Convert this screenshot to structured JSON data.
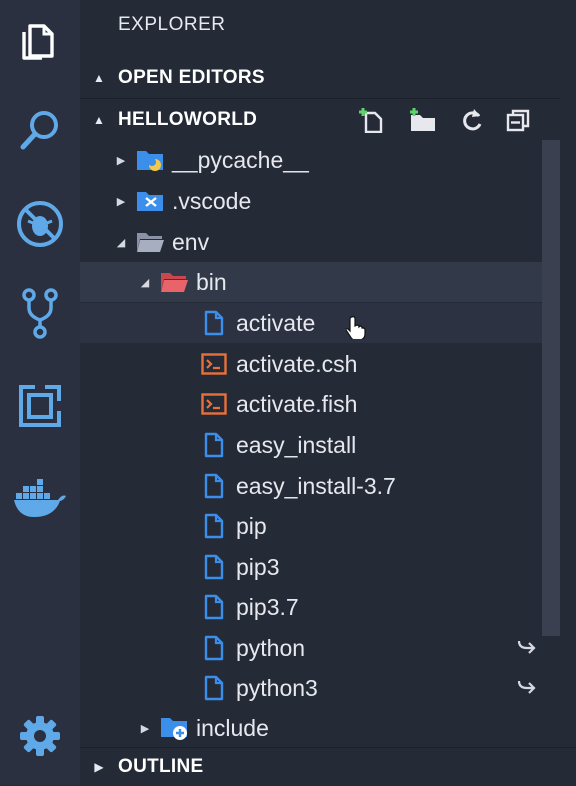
{
  "activity_bar": {
    "items": [
      {
        "icon": "files-icon",
        "active": true
      },
      {
        "icon": "search-icon",
        "active": false
      },
      {
        "icon": "debug-icon",
        "active": false
      },
      {
        "icon": "source-control-icon",
        "active": false
      },
      {
        "icon": "extensions-icon",
        "active": false
      },
      {
        "icon": "docker-icon",
        "active": false
      }
    ],
    "bottom": {
      "icon": "gear-icon"
    }
  },
  "explorer": {
    "title": "EXPLORER",
    "open_editors": "OPEN EDITORS",
    "folder": "HELLOWORLD",
    "outline": "OUTLINE",
    "actions": [
      "new-file-icon",
      "new-folder-icon",
      "refresh-icon",
      "collapse-all-icon"
    ]
  },
  "tree": [
    {
      "name": "__pycache__",
      "kind": "python-folder",
      "twisty": "closed",
      "depth": 1
    },
    {
      "name": ".vscode",
      "kind": "vscode-folder",
      "twisty": "closed",
      "depth": 1
    },
    {
      "name": "env",
      "kind": "folder-open",
      "twisty": "open",
      "depth": 1
    },
    {
      "name": "bin",
      "kind": "folder-red-open",
      "twisty": "open",
      "depth": 2,
      "selected": true
    },
    {
      "name": "activate",
      "kind": "file",
      "depth": 3,
      "hover": true
    },
    {
      "name": "activate.csh",
      "kind": "shell",
      "depth": 3
    },
    {
      "name": "activate.fish",
      "kind": "shell",
      "depth": 3
    },
    {
      "name": "easy_install",
      "kind": "file",
      "depth": 3
    },
    {
      "name": "easy_install-3.7",
      "kind": "file",
      "depth": 3
    },
    {
      "name": "pip",
      "kind": "file",
      "depth": 3
    },
    {
      "name": "pip3",
      "kind": "file",
      "depth": 3
    },
    {
      "name": "pip3.7",
      "kind": "file",
      "depth": 3
    },
    {
      "name": "python",
      "kind": "file",
      "depth": 3,
      "symlink": true
    },
    {
      "name": "python3",
      "kind": "file",
      "depth": 3,
      "symlink": true
    },
    {
      "name": "include",
      "kind": "folder-include",
      "twisty": "closed",
      "depth": 2
    }
  ],
  "colors": {
    "accent_blue": "#3b8eea",
    "shell_orange": "#e8703a",
    "folder_red": "#e8646a",
    "activity_icon": "#5fa9e8"
  }
}
